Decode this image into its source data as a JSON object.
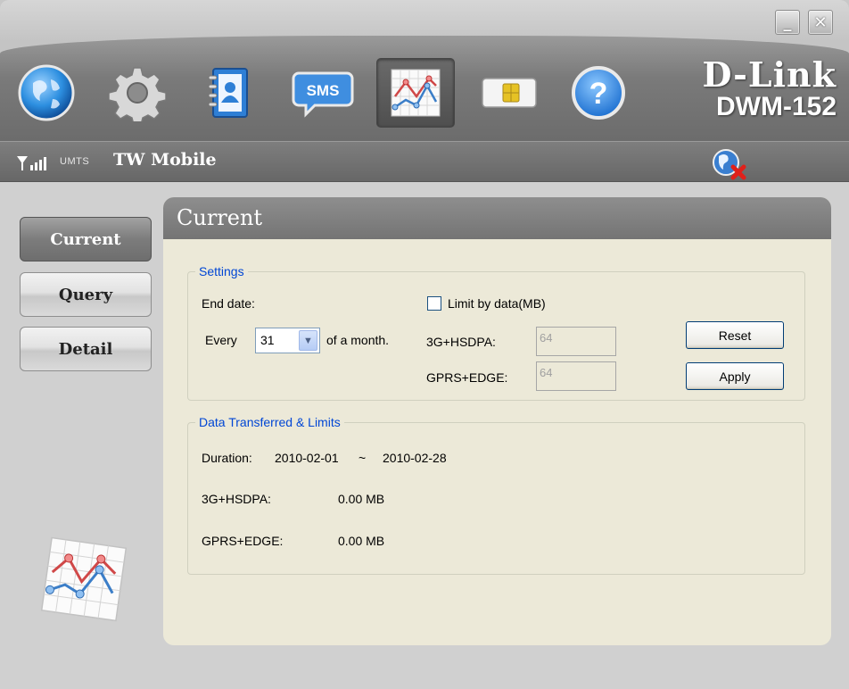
{
  "window": {
    "minimize_label": "_",
    "close_label": "✕"
  },
  "toolbar": {
    "items": [
      {
        "name": "internet",
        "icon": "globe-icon"
      },
      {
        "name": "settings",
        "icon": "gear-icon"
      },
      {
        "name": "contacts",
        "icon": "contacts-icon"
      },
      {
        "name": "sms",
        "icon": "sms-icon",
        "label": "SMS"
      },
      {
        "name": "statistics",
        "icon": "chart-icon",
        "active": true
      },
      {
        "name": "sim",
        "icon": "sim-card-icon"
      },
      {
        "name": "help",
        "icon": "help-icon",
        "label": "?"
      }
    ],
    "brand": "D-Link",
    "model": "DWM-152"
  },
  "status": {
    "network_type": "UMTS",
    "carrier": "TW Mobile",
    "connection_icon": "disconnected-globe-icon"
  },
  "nav": {
    "items": [
      {
        "label": "Current",
        "active": true
      },
      {
        "label": "Query",
        "active": false
      },
      {
        "label": "Detail",
        "active": false
      }
    ]
  },
  "panel": {
    "title": "Current",
    "settings": {
      "legend": "Settings",
      "end_date_label": "End date:",
      "every_label": "Every",
      "day_value": "31",
      "of_month_label": "of a month.",
      "limit_label": "Limit by data(MB)",
      "limit_checked": false,
      "hsdpa_label": "3G+HSDPA:",
      "hsdpa_value": "64",
      "gprs_label": "GPRS+EDGE:",
      "gprs_value": "64",
      "reset_label": "Reset",
      "apply_label": "Apply"
    },
    "transferred": {
      "legend": "Data Transferred & Limits",
      "duration_label": "Duration:",
      "duration_start": "2010-02-01",
      "duration_sep": "~",
      "duration_end": "2010-02-28",
      "hsdpa_label": "3G+HSDPA:",
      "hsdpa_value": "0.00 MB",
      "gprs_label": "GPRS+EDGE:",
      "gprs_value": "0.00 MB"
    }
  },
  "colors": {
    "legend_blue": "#0046d5",
    "panel_bg": "#ece9d8"
  }
}
